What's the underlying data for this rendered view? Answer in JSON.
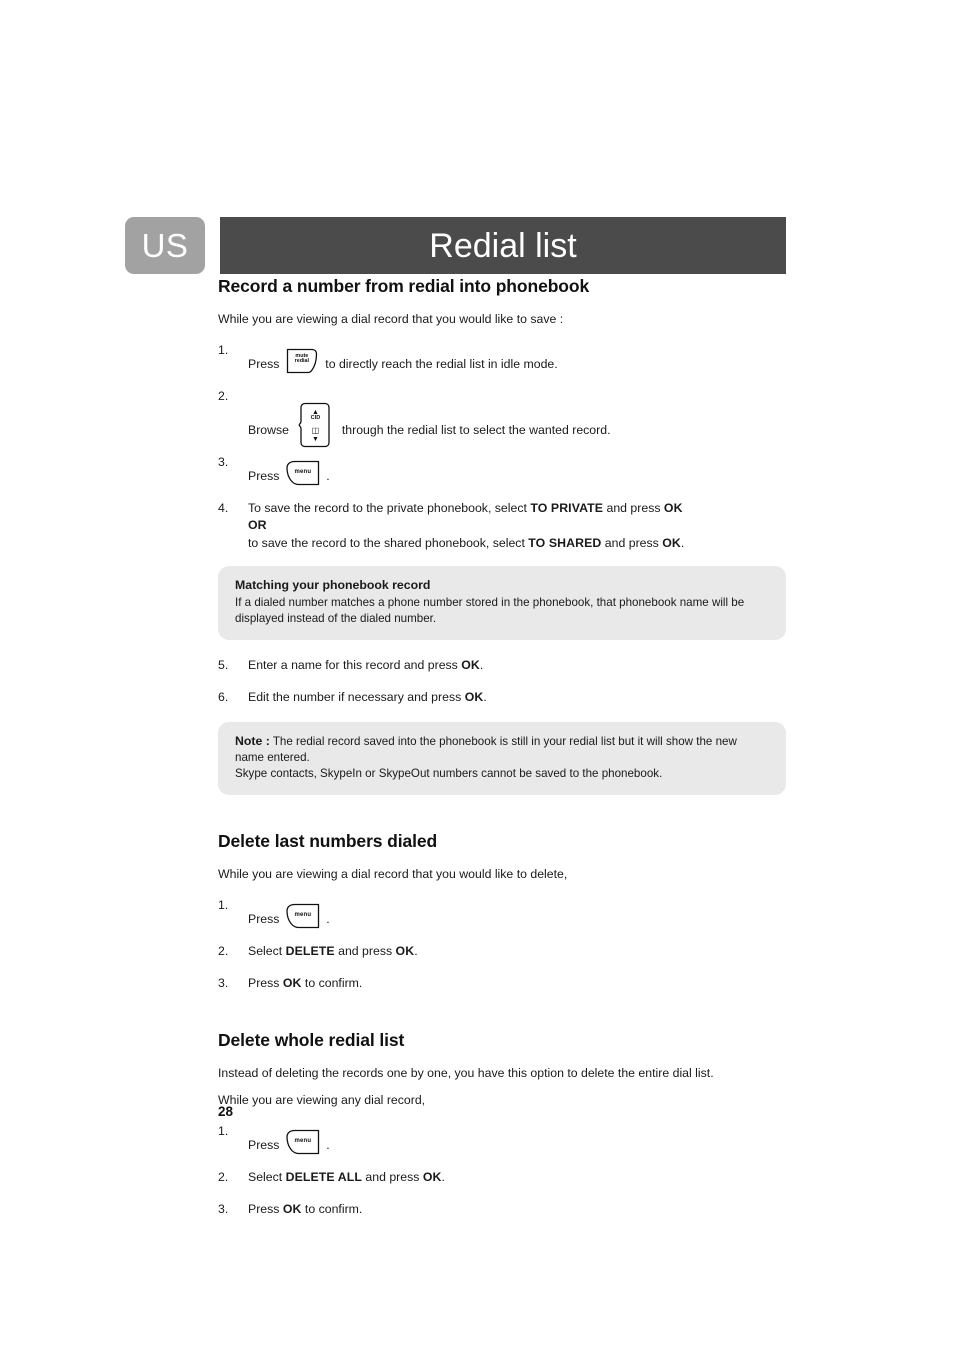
{
  "header": {
    "locale_badge": "US",
    "title": "Redial list"
  },
  "sections": [
    {
      "heading": "Record a number from redial into phonebook",
      "intro": "While you are viewing a dial record that you would like to save :",
      "steps": [
        {
          "num": "1.",
          "pre": "Press",
          "key": "mute-redial",
          "post": "to directly reach the redial list in idle mode."
        },
        {
          "num": "2.",
          "pre": "Browse",
          "key": "cid-navigation",
          "post": "through the redial list to select the wanted record."
        },
        {
          "num": "3.",
          "pre": "Press",
          "key": "menu",
          "post": "."
        },
        {
          "num": "4.",
          "line1_a": "To save the record to the private phonebook, select ",
          "line1_b": "TO PRIVATE",
          "line1_c": " and press ",
          "line1_d": "OK",
          "line2": "OR",
          "line3_a": "to save the record to the shared phonebook, select ",
          "line3_b": "TO SHARED",
          "line3_c": " and press ",
          "line3_d": "OK",
          "line3_e": "."
        },
        {
          "num": "5.",
          "pre": "Enter a name for this record and press ",
          "bold": "OK",
          "post": "."
        },
        {
          "num": "6.",
          "pre": "Edit the number if necessary and press ",
          "bold": "OK",
          "post": "."
        }
      ],
      "callout_matching": {
        "title": "Matching your phonebook record",
        "line1": "If a dialed number matches a phone number stored in the phonebook, that phonebook name will be",
        "line2": "displayed instead of the dialed number."
      },
      "callout_note": {
        "label": "Note :",
        "line1": " The redial record saved into the phonebook is still in your redial list but it will show the new",
        "line2": "name entered.",
        "line3": "Skype contacts, SkypeIn or SkypeOut numbers cannot be saved to the phonebook."
      }
    },
    {
      "heading": "Delete last numbers dialed",
      "intro": "While you are viewing a dial record that you would like to delete,",
      "steps": [
        {
          "num": "1.",
          "pre": "Press",
          "key": "menu",
          "post": "."
        },
        {
          "num": "2.",
          "pre": "Select ",
          "bold": "DELETE",
          "mid": " and press ",
          "bold2": "OK",
          "post": "."
        },
        {
          "num": "3.",
          "pre": "Press ",
          "bold": "OK",
          "mid": " to confirm.",
          "post": ""
        }
      ]
    },
    {
      "heading": "Delete whole redial list",
      "intro": "Instead of deleting the records one by one, you have this option to delete the entire dial list.",
      "intro2": "While you are viewing any dial record,",
      "steps": [
        {
          "num": "1.",
          "pre": "Press",
          "key": "menu",
          "post": "."
        },
        {
          "num": "2.",
          "pre": "Select ",
          "bold": "DELETE ALL",
          "mid": " and press ",
          "bold2": "OK",
          "post": "."
        },
        {
          "num": "3.",
          "pre": "Press ",
          "bold": "OK",
          "mid": " to confirm.",
          "post": ""
        }
      ]
    }
  ],
  "keycaps": {
    "mute_redial": {
      "line1": "mute",
      "line2": "redial"
    },
    "cid_nav": {
      "label": "CID"
    },
    "menu": {
      "label": "menu"
    }
  },
  "footer": {
    "page_number": "28"
  },
  "colors": {
    "badge_gray": "#a2a2a2",
    "header_dark": "#4b4b4b",
    "callout_gray": "#e9e9e9",
    "text": "#1a1a1a"
  }
}
